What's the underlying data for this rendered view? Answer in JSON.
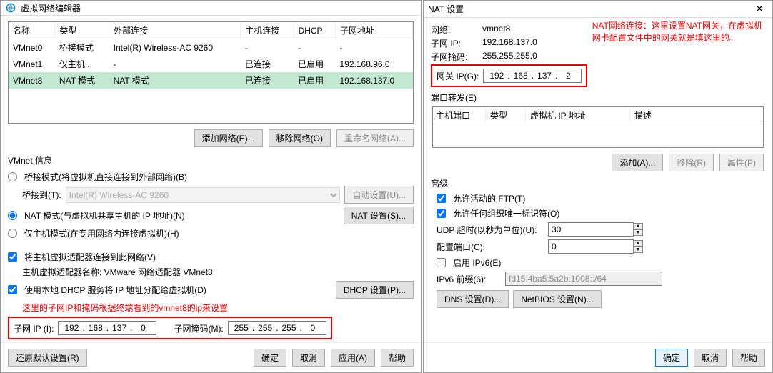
{
  "left": {
    "title": "虚拟网络编辑器",
    "columns": [
      "名称",
      "类型",
      "外部连接",
      "主机连接",
      "DHCP",
      "子网地址"
    ],
    "rows": [
      {
        "c": [
          "VMnet0",
          "桥接模式",
          "Intel(R) Wireless-AC 9260",
          "-",
          "-",
          "-"
        ],
        "sel": false
      },
      {
        "c": [
          "VMnet1",
          "仅主机...",
          "-",
          "已连接",
          "已启用",
          "192.168.96.0"
        ],
        "sel": false
      },
      {
        "c": [
          "VMnet8",
          "NAT 模式",
          "NAT 模式",
          "已连接",
          "已启用",
          "192.168.137.0"
        ],
        "sel": true
      }
    ],
    "buttons": {
      "add_net": "添加网络(E)...",
      "remove_net": "移除网络(O)",
      "rename_net": "重命名网络(A)..."
    },
    "vmnet_info_label": "VMnet 信息",
    "radio_bridged": "桥接模式(将虚拟机直接连接到外部网络)(B)",
    "bridged_to_label": "桥接到(T):",
    "bridged_adapter": "Intel(R) Wireless-AC 9260",
    "auto_settings": "自动设置(U)...",
    "radio_nat": "NAT 模式(与虚拟机共享主机的 IP 地址)(N)",
    "nat_settings": "NAT 设置(S)...",
    "radio_hostonly": "仅主机模式(在专用网络内连接虚拟机)(H)",
    "chk_connect_host": "将主机虚拟适配器连接到此网络(V)",
    "host_adapter_label": "主机虚拟适配器名称: VMware 网络适配器 VMnet8",
    "chk_use_dhcp": "使用本地 DHCP 服务将 IP 地址分配给虚拟机(D)",
    "dhcp_settings": "DHCP 设置(P)...",
    "red_note": "这里的子网IP和掩码根据终端看到的vmnet8的ip来设置",
    "subnet_ip_label": "子网 IP (I):",
    "subnet_ip": [
      "192",
      "168",
      "137",
      "0"
    ],
    "subnet_mask_label": "子网掩码(M):",
    "subnet_mask": [
      "255",
      "255",
      "255",
      "0"
    ],
    "footer": {
      "restore": "还原默认设置(R)",
      "ok": "确定",
      "cancel": "取消",
      "apply": "应用(A)",
      "help": "帮助"
    }
  },
  "right": {
    "title": "NAT 设置",
    "red_note1": "NAT网络连接：这里设置NAT网关，在虚拟机",
    "red_note2": "网卡配置文件中的网关就是填这里的。",
    "network_label": "网络:",
    "network_val": "vmnet8",
    "subnet_label": "子网 IP:",
    "subnet_val": "192.168.137.0",
    "mask_label": "子网掩码:",
    "mask_val": "255.255.255.0",
    "gateway_label": "网关 IP(G):",
    "gateway_ip": [
      "192",
      "168",
      "137",
      "2"
    ],
    "pf_label": "端口转发(E)",
    "pf_cols": {
      "hostport": "主机端口",
      "type": "类型",
      "vmip": "虚拟机 IP 地址",
      "desc": "描述"
    },
    "pf_buttons": {
      "add": "添加(A)...",
      "remove": "移除(R)",
      "props": "属性(P)"
    },
    "adv_label": "高级",
    "chk_ftp": "允许活动的 FTP(T)",
    "chk_oui": "允许任何组织唯一标识符(O)",
    "udp_label": "UDP 超时(以秒为单位)(U):",
    "udp_val": "30",
    "cfg_port_label": "配置端口(C):",
    "cfg_port_val": "0",
    "chk_ipv6": "启用 IPv6(E)",
    "ipv6_prefix_label": "IPv6 前缀(6):",
    "ipv6_prefix_val": "fd15:4ba5:5a2b:1008::/64",
    "dns_btn": "DNS 设置(D)...",
    "netbios_btn": "NetBIOS 设置(N)...",
    "footer": {
      "ok": "确定",
      "cancel": "取消",
      "help": "帮助"
    }
  }
}
